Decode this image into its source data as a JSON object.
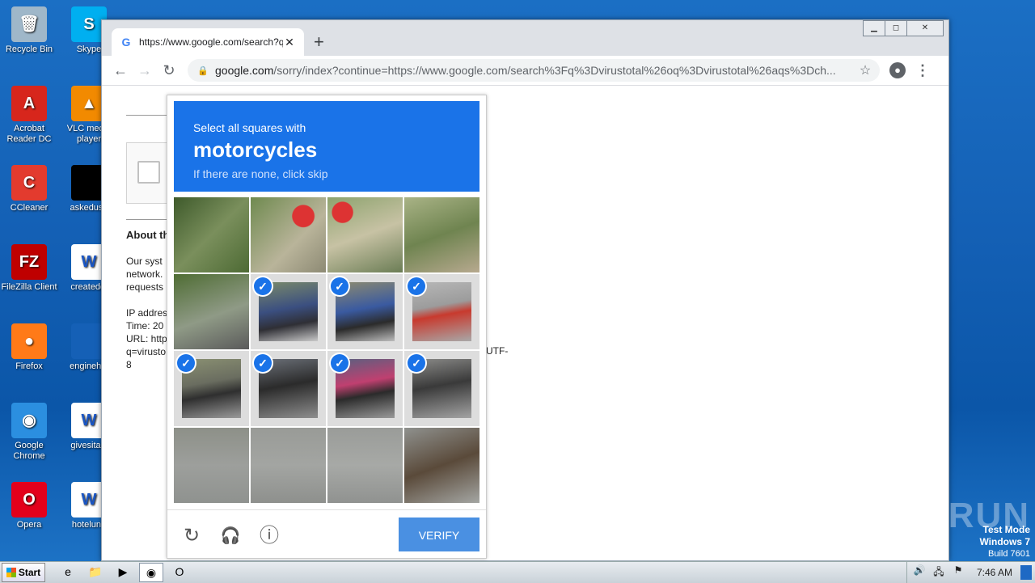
{
  "desktop": {
    "icons": [
      {
        "label": "Recycle Bin",
        "color": "#9fb7c9",
        "glyph": "🗑"
      },
      {
        "label": "Skype",
        "color": "#00aff0",
        "glyph": "S"
      },
      {
        "label": "Acrobat Reader DC",
        "color": "#d7261c",
        "glyph": "A"
      },
      {
        "label": "VLC media player",
        "color": "#f28a00",
        "glyph": "▲"
      },
      {
        "label": "CCleaner",
        "color": "#e33b2e",
        "glyph": "C"
      },
      {
        "label": "askeduse",
        "color": "#000000",
        "glyph": ""
      },
      {
        "label": "FileZilla Client",
        "color": "#bf0000",
        "glyph": "FZ"
      },
      {
        "label": "createddi",
        "color": "#ffffff",
        "glyph": "W"
      },
      {
        "label": "Firefox",
        "color": "#ff7a18",
        "glyph": "●"
      },
      {
        "label": "enginehig",
        "color": "#1560b6",
        "glyph": ""
      },
      {
        "label": "Google Chrome",
        "color": "#2b8fe0",
        "glyph": "◉"
      },
      {
        "label": "givesitaly",
        "color": "#ffffff",
        "glyph": "W"
      },
      {
        "label": "Opera",
        "color": "#e3001b",
        "glyph": "O"
      },
      {
        "label": "hotelund",
        "color": "#ffffff",
        "glyph": "W"
      }
    ]
  },
  "browser": {
    "tab_title": "https://www.google.com/search?q=",
    "tab_close": "✕",
    "new_tab": "+",
    "window_controls": {
      "minimize": "▁",
      "maximize": "◻",
      "close": "✕"
    },
    "nav": {
      "back": "←",
      "forward": "→",
      "reload": "↻"
    },
    "url_host": "google.com",
    "url_rest": "/sorry/index?continue=https://www.google.com/search%3Fq%3Dvirustotal%26oq%3Dvirustotal%26aqs%3Dch...",
    "star": "☆",
    "menu": "⋮"
  },
  "page": {
    "about": "About th",
    "para_lines": [
      "Our syst",
      "network.",
      "requests"
    ],
    "ip_lines": [
      "IP addres",
      "Time: 20",
      "URL: http",
      "q=virusto",
      "8"
    ],
    "utf_fragment": "=UTF-"
  },
  "captcha": {
    "instruction": "Select all squares with",
    "target": "motorcycles",
    "hint": "If there are none, click skip",
    "tiles": [
      {
        "selected": false,
        "bg": "linear-gradient(135deg,#3e5a2b,#7a8f5c 50%,#4d6a34)"
      },
      {
        "selected": false,
        "bg": "radial-gradient(circle at 70% 25%,#d33 0 14%,transparent 15%),linear-gradient(135deg,#6f8a4f,#b9b49a 60%,#8d8a74)"
      },
      {
        "selected": false,
        "bg": "radial-gradient(circle at 20% 20%,#d33 0 12%,transparent 13%),linear-gradient(160deg,#8da36e,#c7c2a4 50%,#6b7d55)"
      },
      {
        "selected": false,
        "bg": "linear-gradient(160deg,#a9b386,#6f8450 50%,#b7a98f)"
      },
      {
        "selected": false,
        "bg": "linear-gradient(160deg,#4f6d34,#8f9a86 55%,#5a5a5a)"
      },
      {
        "selected": true,
        "bg": "linear-gradient(170deg,#7a8a6a,#3b4f80 45%,#2f2f35 70%,#c9c9c9)"
      },
      {
        "selected": true,
        "bg": "linear-gradient(170deg,#8c8a70,#3a5aa0 45%,#2b2b2b 70%,#bbbbbb)"
      },
      {
        "selected": true,
        "bg": "linear-gradient(170deg,#b7b7b7,#9c9c9c 40%,#c83a2e 55%,#a8a8a8)"
      },
      {
        "selected": true,
        "bg": "linear-gradient(170deg,#8a9072,#6a6d60 40%,#2f2f2f 60%,#9a9a9a)"
      },
      {
        "selected": true,
        "bg": "linear-gradient(170deg,#6b7078,#2b2b2b 45%,#8e8e8e)"
      },
      {
        "selected": true,
        "bg": "linear-gradient(170deg,#5a6080,#c04070 40%,#2b2b2b 60%,#999)"
      },
      {
        "selected": true,
        "bg": "linear-gradient(170deg,#8a8a88,#3a3a3a 45%,#a3a3a3)"
      },
      {
        "selected": false,
        "bg": "linear-gradient(180deg,#8d9088,#9d9f9c 50%,#8f928f)"
      },
      {
        "selected": false,
        "bg": "linear-gradient(180deg,#999b97,#a3a5a2 50%,#8e908d)"
      },
      {
        "selected": false,
        "bg": "linear-gradient(180deg,#9a9c99,#a7a9a6 50%,#909290)"
      },
      {
        "selected": false,
        "bg": "linear-gradient(160deg,#8f918e,#5a4a3a 50%,#a4a6a3)"
      }
    ],
    "check_glyph": "✓",
    "reload_icon": "↻",
    "audio_icon": "🎧",
    "info_icon": "ⓘ",
    "verify_label": "VERIFY"
  },
  "overlay": {
    "watermark": "ANY▷RUN",
    "test_mode": "Test Mode",
    "os": "Windows 7",
    "build": "Build 7601"
  },
  "taskbar": {
    "start_label": "Start",
    "apps": [
      "e",
      "📁",
      "▶",
      "◉",
      "O"
    ],
    "tray_icons": [
      "🔊",
      "🖧",
      "⚑"
    ],
    "clock": "7:46 AM"
  }
}
